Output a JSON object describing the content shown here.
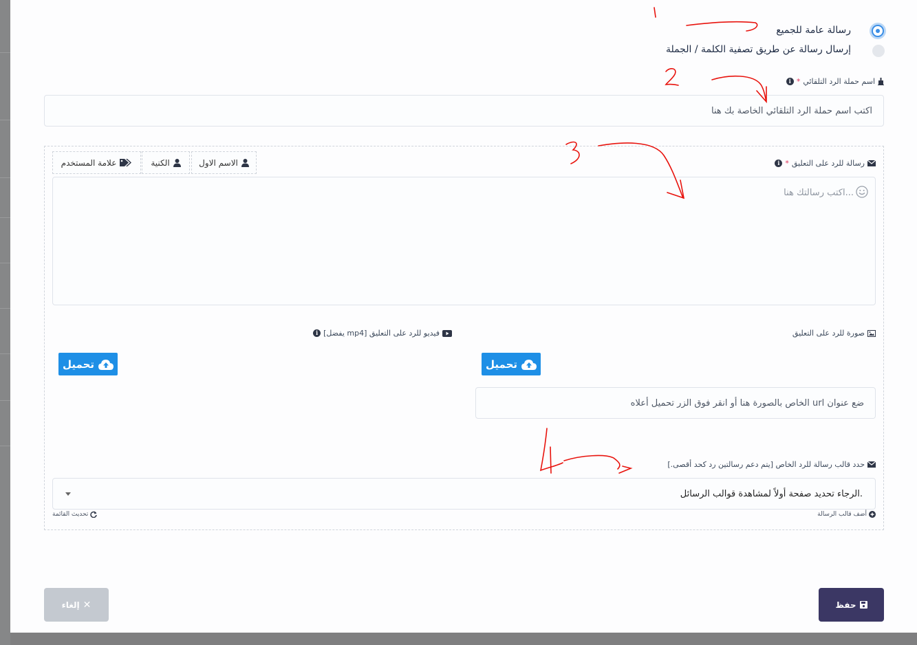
{
  "radios": [
    {
      "label": "رسالة عامة للجميع",
      "checked": true
    },
    {
      "label": "إرسال رسالة عن طريق تصفية الكلمة / الجملة",
      "checked": false
    }
  ],
  "campaign": {
    "label": "اسم حملة الرد التلقائي",
    "required_mark": "*",
    "placeholder": "اكتب اسم حملة الرد التلقائي الخاصة بك هنا"
  },
  "message": {
    "label": "رسالة للرد على التعليق",
    "required_mark": "*",
    "placeholder": "...اكتب رسالتك هنا",
    "tags": [
      "الاسم الاول",
      "الكنية",
      "علامة المستخدم"
    ]
  },
  "image_section": {
    "label": "صورة للرد على التعليق",
    "upload_label": "تحميل",
    "url_placeholder": "ضع عنوان url الخاص بالصورة هنا أو انقر فوق الزر تحميل أعلاه"
  },
  "video_section": {
    "label": "فيديو للرد على التعليق [mp4 يفضل]",
    "upload_label": "تحميل"
  },
  "template_section": {
    "label": "حدد قالب رسالة للرد الخاص [يتم دعم رسالتين رد كحد أقصى.]",
    "select_value": ".الرجاء تحديد صفحة أولاً لمشاهدة قوالب الرسائل",
    "add_template": "أضف قالب الرسالة",
    "refresh_list": "تحديث القائمة"
  },
  "footer": {
    "save_label": "حفظ",
    "cancel_label": "إلغاء"
  },
  "colors": {
    "primary": "#1e8fe6",
    "save": "#3b3764",
    "cancel": "#c4c9d0",
    "annotation": "#e8120c"
  },
  "annotations": [
    "1",
    "2",
    "3",
    "4"
  ]
}
